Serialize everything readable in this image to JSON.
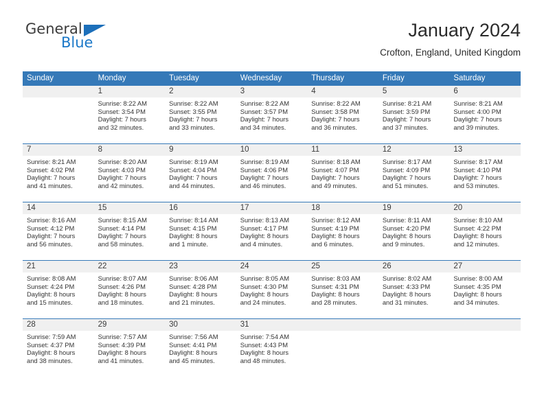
{
  "brand": {
    "name_part1": "General",
    "name_part2": "Blue",
    "triangle_color": "#1c6fba",
    "blue_color": "#1b78c8"
  },
  "header": {
    "title": "January 2024",
    "subtitle": "Crofton, England, United Kingdom"
  },
  "theme": {
    "header_bg": "#3579b8",
    "daynum_bg": "#f0f0f0",
    "text": "#333333"
  },
  "weekday_headers": [
    "Sunday",
    "Monday",
    "Tuesday",
    "Wednesday",
    "Thursday",
    "Friday",
    "Saturday"
  ],
  "weeks": [
    [
      {
        "day": "",
        "empty": true,
        "sunrise": "",
        "sunset": "",
        "daylight_1": "",
        "daylight_2": ""
      },
      {
        "day": "1",
        "sunrise": "Sunrise: 8:22 AM",
        "sunset": "Sunset: 3:54 PM",
        "daylight_1": "Daylight: 7 hours",
        "daylight_2": "and 32 minutes."
      },
      {
        "day": "2",
        "sunrise": "Sunrise: 8:22 AM",
        "sunset": "Sunset: 3:55 PM",
        "daylight_1": "Daylight: 7 hours",
        "daylight_2": "and 33 minutes."
      },
      {
        "day": "3",
        "sunrise": "Sunrise: 8:22 AM",
        "sunset": "Sunset: 3:57 PM",
        "daylight_1": "Daylight: 7 hours",
        "daylight_2": "and 34 minutes."
      },
      {
        "day": "4",
        "sunrise": "Sunrise: 8:22 AM",
        "sunset": "Sunset: 3:58 PM",
        "daylight_1": "Daylight: 7 hours",
        "daylight_2": "and 36 minutes."
      },
      {
        "day": "5",
        "sunrise": "Sunrise: 8:21 AM",
        "sunset": "Sunset: 3:59 PM",
        "daylight_1": "Daylight: 7 hours",
        "daylight_2": "and 37 minutes."
      },
      {
        "day": "6",
        "sunrise": "Sunrise: 8:21 AM",
        "sunset": "Sunset: 4:00 PM",
        "daylight_1": "Daylight: 7 hours",
        "daylight_2": "and 39 minutes."
      }
    ],
    [
      {
        "day": "7",
        "sunrise": "Sunrise: 8:21 AM",
        "sunset": "Sunset: 4:02 PM",
        "daylight_1": "Daylight: 7 hours",
        "daylight_2": "and 41 minutes."
      },
      {
        "day": "8",
        "sunrise": "Sunrise: 8:20 AM",
        "sunset": "Sunset: 4:03 PM",
        "daylight_1": "Daylight: 7 hours",
        "daylight_2": "and 42 minutes."
      },
      {
        "day": "9",
        "sunrise": "Sunrise: 8:19 AM",
        "sunset": "Sunset: 4:04 PM",
        "daylight_1": "Daylight: 7 hours",
        "daylight_2": "and 44 minutes."
      },
      {
        "day": "10",
        "sunrise": "Sunrise: 8:19 AM",
        "sunset": "Sunset: 4:06 PM",
        "daylight_1": "Daylight: 7 hours",
        "daylight_2": "and 46 minutes."
      },
      {
        "day": "11",
        "sunrise": "Sunrise: 8:18 AM",
        "sunset": "Sunset: 4:07 PM",
        "daylight_1": "Daylight: 7 hours",
        "daylight_2": "and 49 minutes."
      },
      {
        "day": "12",
        "sunrise": "Sunrise: 8:17 AM",
        "sunset": "Sunset: 4:09 PM",
        "daylight_1": "Daylight: 7 hours",
        "daylight_2": "and 51 minutes."
      },
      {
        "day": "13",
        "sunrise": "Sunrise: 8:17 AM",
        "sunset": "Sunset: 4:10 PM",
        "daylight_1": "Daylight: 7 hours",
        "daylight_2": "and 53 minutes."
      }
    ],
    [
      {
        "day": "14",
        "sunrise": "Sunrise: 8:16 AM",
        "sunset": "Sunset: 4:12 PM",
        "daylight_1": "Daylight: 7 hours",
        "daylight_2": "and 56 minutes."
      },
      {
        "day": "15",
        "sunrise": "Sunrise: 8:15 AM",
        "sunset": "Sunset: 4:14 PM",
        "daylight_1": "Daylight: 7 hours",
        "daylight_2": "and 58 minutes."
      },
      {
        "day": "16",
        "sunrise": "Sunrise: 8:14 AM",
        "sunset": "Sunset: 4:15 PM",
        "daylight_1": "Daylight: 8 hours",
        "daylight_2": "and 1 minute."
      },
      {
        "day": "17",
        "sunrise": "Sunrise: 8:13 AM",
        "sunset": "Sunset: 4:17 PM",
        "daylight_1": "Daylight: 8 hours",
        "daylight_2": "and 4 minutes."
      },
      {
        "day": "18",
        "sunrise": "Sunrise: 8:12 AM",
        "sunset": "Sunset: 4:19 PM",
        "daylight_1": "Daylight: 8 hours",
        "daylight_2": "and 6 minutes."
      },
      {
        "day": "19",
        "sunrise": "Sunrise: 8:11 AM",
        "sunset": "Sunset: 4:20 PM",
        "daylight_1": "Daylight: 8 hours",
        "daylight_2": "and 9 minutes."
      },
      {
        "day": "20",
        "sunrise": "Sunrise: 8:10 AM",
        "sunset": "Sunset: 4:22 PM",
        "daylight_1": "Daylight: 8 hours",
        "daylight_2": "and 12 minutes."
      }
    ],
    [
      {
        "day": "21",
        "sunrise": "Sunrise: 8:08 AM",
        "sunset": "Sunset: 4:24 PM",
        "daylight_1": "Daylight: 8 hours",
        "daylight_2": "and 15 minutes."
      },
      {
        "day": "22",
        "sunrise": "Sunrise: 8:07 AM",
        "sunset": "Sunset: 4:26 PM",
        "daylight_1": "Daylight: 8 hours",
        "daylight_2": "and 18 minutes."
      },
      {
        "day": "23",
        "sunrise": "Sunrise: 8:06 AM",
        "sunset": "Sunset: 4:28 PM",
        "daylight_1": "Daylight: 8 hours",
        "daylight_2": "and 21 minutes."
      },
      {
        "day": "24",
        "sunrise": "Sunrise: 8:05 AM",
        "sunset": "Sunset: 4:30 PM",
        "daylight_1": "Daylight: 8 hours",
        "daylight_2": "and 24 minutes."
      },
      {
        "day": "25",
        "sunrise": "Sunrise: 8:03 AM",
        "sunset": "Sunset: 4:31 PM",
        "daylight_1": "Daylight: 8 hours",
        "daylight_2": "and 28 minutes."
      },
      {
        "day": "26",
        "sunrise": "Sunrise: 8:02 AM",
        "sunset": "Sunset: 4:33 PM",
        "daylight_1": "Daylight: 8 hours",
        "daylight_2": "and 31 minutes."
      },
      {
        "day": "27",
        "sunrise": "Sunrise: 8:00 AM",
        "sunset": "Sunset: 4:35 PM",
        "daylight_1": "Daylight: 8 hours",
        "daylight_2": "and 34 minutes."
      }
    ],
    [
      {
        "day": "28",
        "sunrise": "Sunrise: 7:59 AM",
        "sunset": "Sunset: 4:37 PM",
        "daylight_1": "Daylight: 8 hours",
        "daylight_2": "and 38 minutes."
      },
      {
        "day": "29",
        "sunrise": "Sunrise: 7:57 AM",
        "sunset": "Sunset: 4:39 PM",
        "daylight_1": "Daylight: 8 hours",
        "daylight_2": "and 41 minutes."
      },
      {
        "day": "30",
        "sunrise": "Sunrise: 7:56 AM",
        "sunset": "Sunset: 4:41 PM",
        "daylight_1": "Daylight: 8 hours",
        "daylight_2": "and 45 minutes."
      },
      {
        "day": "31",
        "sunrise": "Sunrise: 7:54 AM",
        "sunset": "Sunset: 4:43 PM",
        "daylight_1": "Daylight: 8 hours",
        "daylight_2": "and 48 minutes."
      },
      {
        "day": "",
        "empty": true,
        "sunrise": "",
        "sunset": "",
        "daylight_1": "",
        "daylight_2": ""
      },
      {
        "day": "",
        "empty": true,
        "sunrise": "",
        "sunset": "",
        "daylight_1": "",
        "daylight_2": ""
      },
      {
        "day": "",
        "empty": true,
        "sunrise": "",
        "sunset": "",
        "daylight_1": "",
        "daylight_2": ""
      }
    ]
  ]
}
